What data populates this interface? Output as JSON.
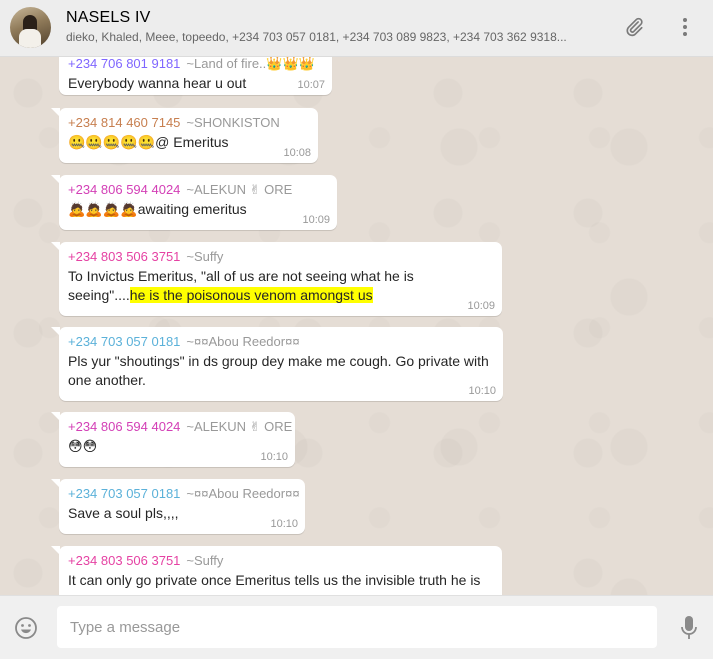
{
  "header": {
    "title": "NASELS IV",
    "subtitle": "dieko, Khaled, Meee, topeedo, +234 703 057 0181, +234 703 089 9823, +234 703 362 9318..."
  },
  "messages": [
    {
      "number": "+234 706 801 9181",
      "nick": "~Land of fire..👑👑👑",
      "number_color": "#7f66ff",
      "text": "Everybody wanna hear u out",
      "time": "10:07"
    },
    {
      "number": "+234 814 460 7145",
      "nick": "~SHONKISTON",
      "number_color": "#c77f4f",
      "text": "🤐🤐🤐🤐🤐@ Emeritus",
      "time": "10:08"
    },
    {
      "number": "+234 806 594 4024",
      "nick": "~ALEKUN ✌ ORE",
      "number_color": "#d33fb6",
      "text": "🙇🙇🙇🙇awaiting emeritus",
      "time": "10:09"
    },
    {
      "number": "+234 803 506 3751",
      "nick": "~Suffy",
      "number_color": "#e542a3",
      "text_pre": "To Invictus Emeritus, \"all of us are not seeing what he is seeing\"....",
      "text_hl": "he is the poisonous venom amongst us",
      "time": "10:09"
    },
    {
      "number": "+234 703 057 0181",
      "nick": "~¤¤Abou Reedor¤¤",
      "number_color": "#5bb1d9",
      "text": "Pls yur \"shoutings\" in ds group dey make me cough. Go private with one another.",
      "time": "10:10"
    },
    {
      "number": "+234 806 594 4024",
      "nick": "~ALEKUN ✌ ORE",
      "number_color": "#d33fb6",
      "text": "😳😳",
      "time": "10:10"
    },
    {
      "number": "+234 703 057 0181",
      "nick": "~¤¤Abou Reedor¤¤",
      "number_color": "#5bb1d9",
      "text": "Save a soul pls,,,,",
      "time": "10:10"
    },
    {
      "number": "+234 803 506 3751",
      "nick": "~Suffy",
      "number_color": "#e542a3",
      "text": "It can only go private once Emeritus tells us the invisible truth he is",
      "time": ""
    }
  ],
  "composer": {
    "placeholder": "Type a message"
  },
  "icons": {
    "attach": "paperclip-icon",
    "menu": "more-vertical-icon",
    "emoji": "smiley-icon",
    "mic": "microphone-icon"
  },
  "colors": {
    "highlight": "#ffff00",
    "header_bg": "#ededed",
    "chat_bg": "#e5ddd5"
  }
}
